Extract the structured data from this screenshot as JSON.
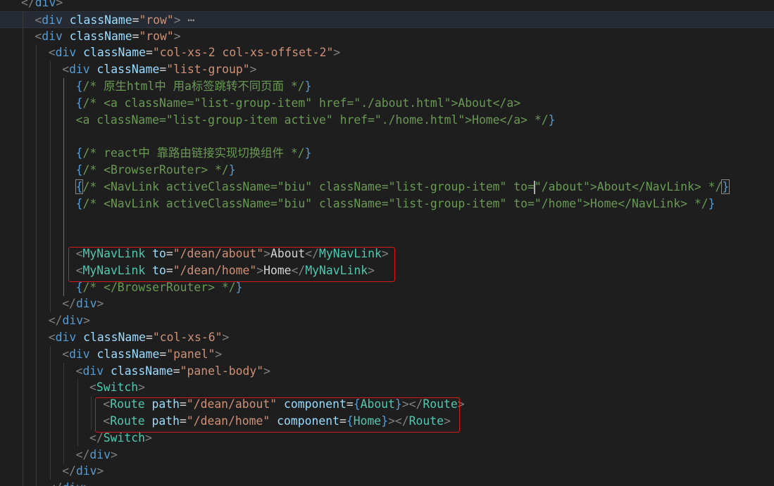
{
  "accent": "#d7191c",
  "lines": [
    {
      "indent": 1,
      "tokens": [
        [
          "p",
          "</"
        ],
        [
          "t",
          "div"
        ],
        [
          "p",
          ">"
        ]
      ]
    },
    {
      "indent": 2,
      "current": true,
      "tokens": [
        [
          "p",
          "<"
        ],
        [
          "t",
          "div"
        ],
        [
          "o",
          " "
        ],
        [
          "a",
          "className"
        ],
        [
          "o",
          "="
        ],
        [
          "s",
          "\"row\""
        ],
        [
          "p",
          ">"
        ],
        [
          "f",
          " ⋯"
        ]
      ]
    },
    {
      "indent": 2,
      "tokens": [
        [
          "p",
          "<"
        ],
        [
          "t",
          "div"
        ],
        [
          "o",
          " "
        ],
        [
          "a",
          "className"
        ],
        [
          "o",
          "="
        ],
        [
          "s",
          "\"row\""
        ],
        [
          "p",
          ">"
        ]
      ]
    },
    {
      "indent": 3,
      "tokens": [
        [
          "p",
          "<"
        ],
        [
          "t",
          "div"
        ],
        [
          "o",
          " "
        ],
        [
          "a",
          "className"
        ],
        [
          "o",
          "="
        ],
        [
          "s",
          "\"col-xs-2 col-xs-offset-2\""
        ],
        [
          "p",
          ">"
        ]
      ]
    },
    {
      "indent": 4,
      "tokens": [
        [
          "p",
          "<"
        ],
        [
          "t",
          "div"
        ],
        [
          "o",
          " "
        ],
        [
          "a",
          "className"
        ],
        [
          "o",
          "="
        ],
        [
          "s",
          "\"list-group\""
        ],
        [
          "p",
          ">"
        ]
      ]
    },
    {
      "indent": 5,
      "tokens": [
        [
          "b",
          "{"
        ],
        [
          "m",
          "/* 原生html中 用a标签跳转不同页面 */"
        ],
        [
          "b",
          "}"
        ]
      ]
    },
    {
      "indent": 5,
      "tokens": [
        [
          "b",
          "{"
        ],
        [
          "m",
          "/* <a className=\"list-group-item\" href=\"./about.html\">About</a>"
        ]
      ]
    },
    {
      "indent": 5,
      "tokens": [
        [
          "m",
          "<a className=\"list-group-item active\" href=\"./home.html\">Home</a> */"
        ],
        [
          "b",
          "}"
        ]
      ]
    },
    {
      "indent": 0,
      "tokens": []
    },
    {
      "indent": 5,
      "tokens": [
        [
          "b",
          "{"
        ],
        [
          "m",
          "/* react中 靠路由链接实现切换组件 */"
        ],
        [
          "b",
          "}"
        ]
      ]
    },
    {
      "indent": 5,
      "tokens": [
        [
          "b",
          "{"
        ],
        [
          "m",
          "/* <BrowserRouter> */"
        ],
        [
          "b",
          "}"
        ]
      ]
    },
    {
      "indent": 5,
      "tokens": [
        [
          "bm",
          "{"
        ],
        [
          "m",
          "/* <NavLink activeClassName=\"biu\" className=\"list-group-item\" to="
        ],
        [
          "c",
          ""
        ],
        [
          "m",
          "\"/about\">About</NavLink> */"
        ],
        [
          "bm",
          "}"
        ]
      ]
    },
    {
      "indent": 5,
      "tokens": [
        [
          "b",
          "{"
        ],
        [
          "m",
          "/* <NavLink activeClassName=\"biu\" className=\"list-group-item\" to=\"/home\">Home</NavLink> */"
        ],
        [
          "b",
          "}"
        ]
      ]
    },
    {
      "indent": 0,
      "tokens": []
    },
    {
      "indent": 0,
      "tokens": []
    },
    {
      "indent": 5,
      "tokens": [
        [
          "p",
          "<"
        ],
        [
          "k",
          "MyNavLink"
        ],
        [
          "o",
          " "
        ],
        [
          "a",
          "to"
        ],
        [
          "o",
          "="
        ],
        [
          "s",
          "\"/dean/about\""
        ],
        [
          "p",
          ">"
        ],
        [
          "x",
          "About"
        ],
        [
          "p",
          "</"
        ],
        [
          "k",
          "MyNavLink"
        ],
        [
          "p",
          ">"
        ]
      ]
    },
    {
      "indent": 5,
      "tokens": [
        [
          "p",
          "<"
        ],
        [
          "k",
          "MyNavLink"
        ],
        [
          "o",
          " "
        ],
        [
          "a",
          "to"
        ],
        [
          "o",
          "="
        ],
        [
          "s",
          "\"/dean/home\""
        ],
        [
          "p",
          ">"
        ],
        [
          "x",
          "Home"
        ],
        [
          "p",
          "</"
        ],
        [
          "k",
          "MyNavLink"
        ],
        [
          "p",
          ">"
        ]
      ]
    },
    {
      "indent": 5,
      "tokens": [
        [
          "b",
          "{"
        ],
        [
          "m",
          "/* </BrowserRouter> */"
        ],
        [
          "b",
          "}"
        ]
      ]
    },
    {
      "indent": 4,
      "tokens": [
        [
          "p",
          "</"
        ],
        [
          "t",
          "div"
        ],
        [
          "p",
          ">"
        ]
      ]
    },
    {
      "indent": 3,
      "tokens": [
        [
          "p",
          "</"
        ],
        [
          "t",
          "div"
        ],
        [
          "p",
          ">"
        ]
      ]
    },
    {
      "indent": 3,
      "tokens": [
        [
          "p",
          "<"
        ],
        [
          "t",
          "div"
        ],
        [
          "o",
          " "
        ],
        [
          "a",
          "className"
        ],
        [
          "o",
          "="
        ],
        [
          "s",
          "\"col-xs-6\""
        ],
        [
          "p",
          ">"
        ]
      ]
    },
    {
      "indent": 4,
      "tokens": [
        [
          "p",
          "<"
        ],
        [
          "t",
          "div"
        ],
        [
          "o",
          " "
        ],
        [
          "a",
          "className"
        ],
        [
          "o",
          "="
        ],
        [
          "s",
          "\"panel\""
        ],
        [
          "p",
          ">"
        ]
      ]
    },
    {
      "indent": 5,
      "tokens": [
        [
          "p",
          "<"
        ],
        [
          "t",
          "div"
        ],
        [
          "o",
          " "
        ],
        [
          "a",
          "className"
        ],
        [
          "o",
          "="
        ],
        [
          "s",
          "\"panel-body\""
        ],
        [
          "p",
          ">"
        ]
      ]
    },
    {
      "indent": 6,
      "tokens": [
        [
          "p",
          "<"
        ],
        [
          "k",
          "Switch"
        ],
        [
          "p",
          ">"
        ]
      ]
    },
    {
      "indent": 7,
      "tokens": [
        [
          "p",
          "<"
        ],
        [
          "k",
          "Route"
        ],
        [
          "o",
          " "
        ],
        [
          "a",
          "path"
        ],
        [
          "o",
          "="
        ],
        [
          "s",
          "\"/dean/about\""
        ],
        [
          "o",
          " "
        ],
        [
          "a",
          "component"
        ],
        [
          "o",
          "="
        ],
        [
          "b",
          "{"
        ],
        [
          "k",
          "About"
        ],
        [
          "b",
          "}"
        ],
        [
          "p",
          "></"
        ],
        [
          "k",
          "Route"
        ],
        [
          "p",
          ">"
        ]
      ]
    },
    {
      "indent": 7,
      "tokens": [
        [
          "p",
          "<"
        ],
        [
          "k",
          "Route"
        ],
        [
          "o",
          " "
        ],
        [
          "a",
          "path"
        ],
        [
          "o",
          "="
        ],
        [
          "s",
          "\"/dean/home\""
        ],
        [
          "o",
          " "
        ],
        [
          "a",
          "component"
        ],
        [
          "o",
          "="
        ],
        [
          "b",
          "{"
        ],
        [
          "k",
          "Home"
        ],
        [
          "b",
          "}"
        ],
        [
          "p",
          "></"
        ],
        [
          "k",
          "Route"
        ],
        [
          "p",
          ">"
        ]
      ]
    },
    {
      "indent": 6,
      "tokens": [
        [
          "p",
          "</"
        ],
        [
          "k",
          "Switch"
        ],
        [
          "p",
          ">"
        ]
      ]
    },
    {
      "indent": 5,
      "tokens": [
        [
          "p",
          "</"
        ],
        [
          "t",
          "div"
        ],
        [
          "p",
          ">"
        ]
      ]
    },
    {
      "indent": 4,
      "tokens": [
        [
          "p",
          "</"
        ],
        [
          "t",
          "div"
        ],
        [
          "p",
          ">"
        ]
      ]
    },
    {
      "indent": 3,
      "tokens": [
        [
          "p",
          "</"
        ],
        [
          "t",
          "div"
        ],
        [
          "p",
          ">"
        ]
      ]
    }
  ],
  "highlights": [
    {
      "from_line": 15,
      "to_line": 16,
      "col_start": 5,
      "col_end": 24
    },
    {
      "from_line": 24,
      "to_line": 25,
      "col_start": 7,
      "col_end": 26
    }
  ]
}
